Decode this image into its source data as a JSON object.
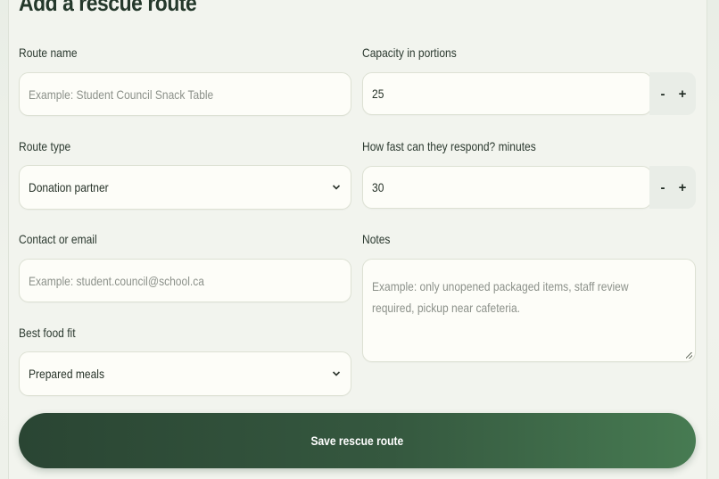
{
  "form": {
    "title": "Add a rescue route",
    "route_name": {
      "label": "Route name",
      "placeholder": "Example: Student Council Snack Table",
      "value": ""
    },
    "capacity": {
      "label": "Capacity in portions",
      "value": "25",
      "decrement": "-",
      "increment": "+"
    },
    "route_type": {
      "label": "Route type",
      "value": "Donation partner",
      "icon": "chevron-down-icon"
    },
    "response_time": {
      "label": "How fast can they respond? minutes",
      "value": "30",
      "decrement": "-",
      "increment": "+"
    },
    "contact": {
      "label": "Contact or email",
      "placeholder": "Example: student.council@school.ca",
      "value": ""
    },
    "notes": {
      "label": "Notes",
      "placeholder": "Example: only unopened packaged items, staff review required, pickup near cafeteria.",
      "value": ""
    },
    "food_fit": {
      "label": "Best food fit",
      "value": "Prepared meals",
      "icon": "chevron-down-icon"
    },
    "save_label": "Save rescue route"
  },
  "colors": {
    "accent": "#35583f",
    "text": "#273329",
    "field_bg": "#fdfdf8"
  }
}
